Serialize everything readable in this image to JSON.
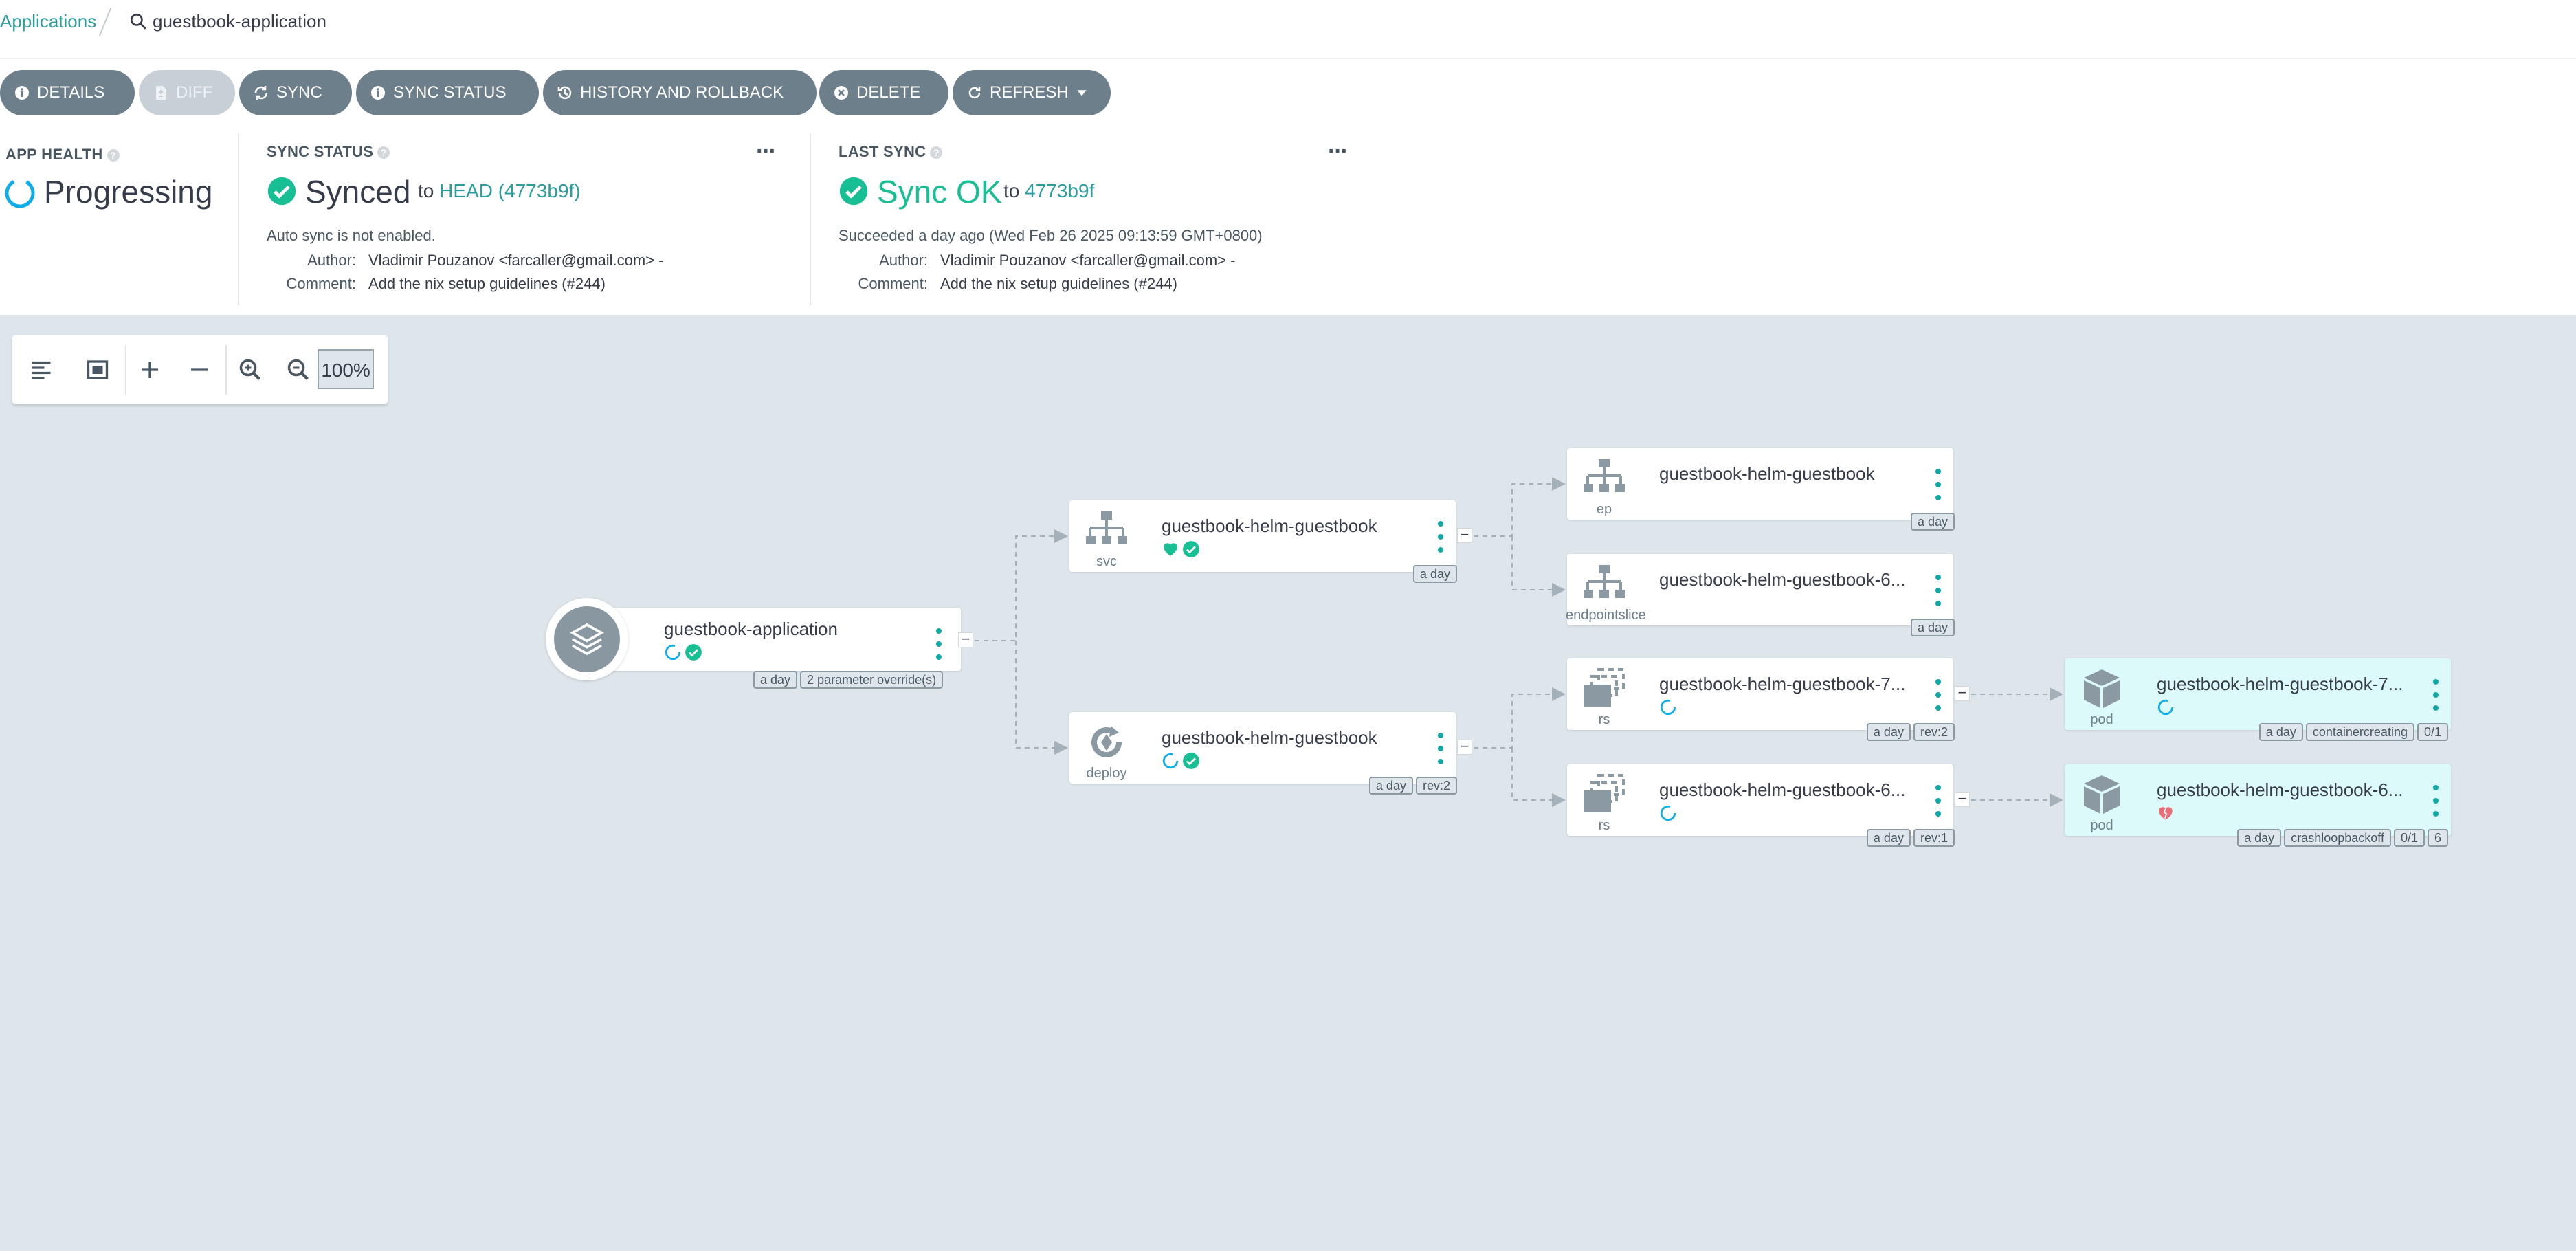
{
  "breadcrumb": {
    "root": "Applications",
    "current": "guestbook-application"
  },
  "actions": [
    {
      "label": "DETAILS",
      "icon": "info-icon",
      "enabled": true
    },
    {
      "label": "DIFF",
      "icon": "file-diff-icon",
      "enabled": false
    },
    {
      "label": "SYNC",
      "icon": "sync-icon",
      "enabled": true
    },
    {
      "label": "SYNC STATUS",
      "icon": "info-icon",
      "enabled": true
    },
    {
      "label": "HISTORY AND ROLLBACK",
      "icon": "history-icon",
      "enabled": true
    },
    {
      "label": "DELETE",
      "icon": "close-circle-icon",
      "enabled": true
    },
    {
      "label": "REFRESH",
      "icon": "refresh-icon",
      "enabled": true
    }
  ],
  "app_health": {
    "title": "APP HEALTH",
    "status": "Progressing"
  },
  "sync_status": {
    "title": "SYNC STATUS",
    "status": "Synced",
    "to_prefix": "to",
    "revision": "HEAD (4773b9f)",
    "note": "Auto sync is not enabled.",
    "author_label": "Author:",
    "author": "Vladimir Pouzanov <farcaller@gmail.com> -",
    "comment_label": "Comment:",
    "comment": "Add the nix setup guidelines (#244)"
  },
  "last_sync": {
    "title": "LAST SYNC",
    "status": "Sync OK",
    "to_prefix": "to",
    "revision": "4773b9f",
    "note": "Succeeded a day ago (Wed Feb 26 2025 09:13:59 GMT+0800)",
    "author_label": "Author:",
    "author": "Vladimir Pouzanov <farcaller@gmail.com> -",
    "comment_label": "Comment:",
    "comment": "Add the nix setup guidelines (#244)"
  },
  "toolbar": {
    "zoom": "100%"
  },
  "graph": {
    "app": {
      "name": "guestbook-application",
      "tags": [
        "a day",
        "2 parameter override(s)"
      ]
    },
    "svc": {
      "name": "guestbook-helm-guestbook",
      "kind": "svc",
      "tags": [
        "a day"
      ]
    },
    "deploy": {
      "name": "guestbook-helm-guestbook",
      "kind": "deploy",
      "tags": [
        "a day",
        "rev:2"
      ]
    },
    "ep": {
      "name": "guestbook-helm-guestbook",
      "kind": "ep",
      "tags": [
        "a day"
      ]
    },
    "endpointslice": {
      "name": "guestbook-helm-guestbook-6...",
      "kind": "endpointslice",
      "tags": [
        "a day"
      ]
    },
    "rs1": {
      "name": "guestbook-helm-guestbook-7...",
      "kind": "rs",
      "tags": [
        "a day",
        "rev:2"
      ]
    },
    "rs2": {
      "name": "guestbook-helm-guestbook-6...",
      "kind": "rs",
      "tags": [
        "a day",
        "rev:1"
      ]
    },
    "pod1": {
      "name": "guestbook-helm-guestbook-7...",
      "kind": "pod",
      "tags": [
        "a day",
        "containercreating",
        "0/1"
      ]
    },
    "pod2": {
      "name": "guestbook-helm-guestbook-6...",
      "kind": "pod",
      "tags": [
        "a day",
        "crashloopbackoff",
        "0/1",
        "6"
      ]
    }
  },
  "colors": {
    "accent": "#2a9d9d",
    "ok": "#18be94",
    "progress": "#0dadea",
    "degraded": "#e96d76",
    "button": "#6d7f8b"
  }
}
